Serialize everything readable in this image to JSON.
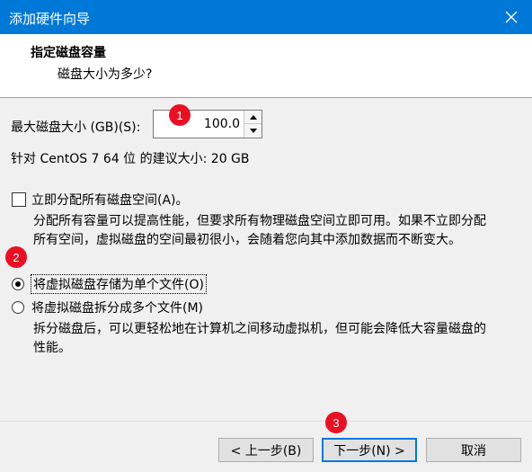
{
  "window": {
    "title": "添加硬件向导"
  },
  "header": {
    "title": "指定磁盘容量",
    "subtitle": "磁盘大小为多少?"
  },
  "disk_size": {
    "label": "最大磁盘大小 (GB)(S):",
    "value": "100.0"
  },
  "recommend_text": "针对 CentOS 7 64 位 的建议大小: 20 GB",
  "allocate": {
    "label": "立即分配所有磁盘空间(A)。",
    "checked": false,
    "desc_line1": "分配所有容量可以提高性能，但要求所有物理磁盘空间立即可用。如果不立即分配",
    "desc_line2": "所有空间，虚拟磁盘的空间最初很小，会随着您向其中添加数据而不断变大。"
  },
  "options": [
    {
      "label": "将虚拟磁盘存储为单个文件(O)",
      "selected": true
    },
    {
      "label": "将虚拟磁盘拆分成多个文件(M)",
      "selected": false
    }
  ],
  "split_desc_line1": "拆分磁盘后，可以更轻松地在计算机之间移动虚拟机，但可能会降低大容量磁盘的",
  "split_desc_line2": "性能。",
  "buttons": {
    "back": "< 上一步(B)",
    "next": "下一步(N) >",
    "cancel": "取消"
  },
  "markers": [
    "1",
    "2",
    "3"
  ],
  "colors": {
    "titlebar": "#0078d7",
    "marker": "#e81123"
  }
}
